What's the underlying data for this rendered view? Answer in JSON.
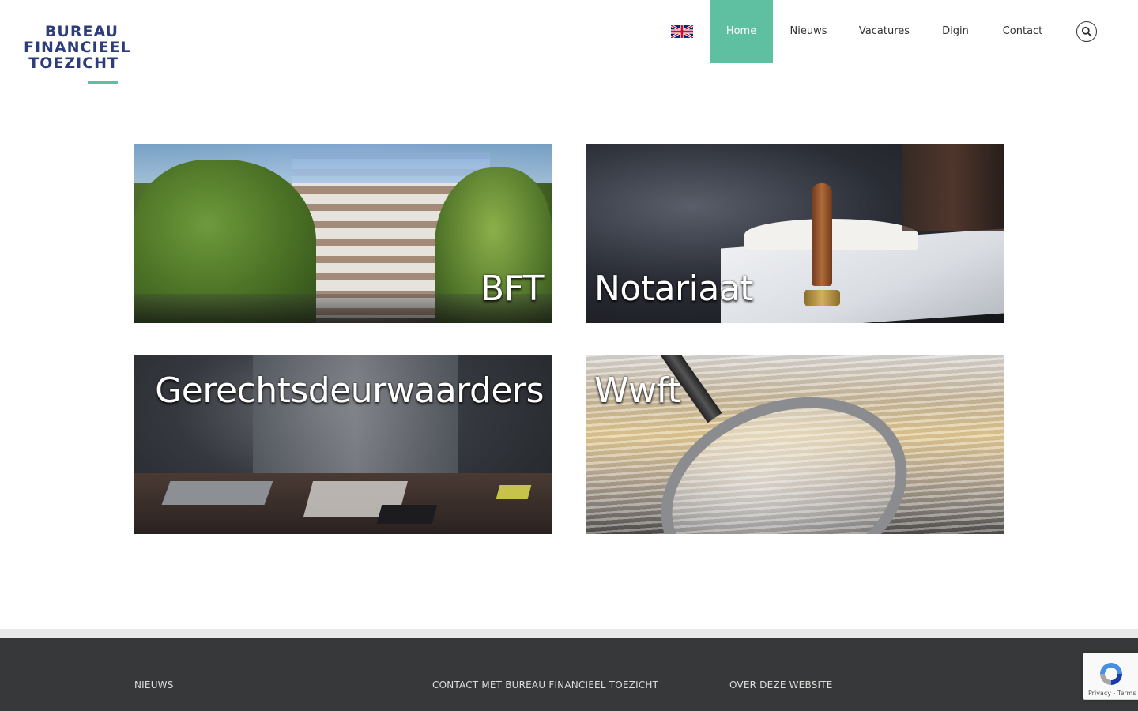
{
  "header": {
    "logo_lines": [
      "BUREAU",
      "FINANCIEEL",
      "TOEZICHT"
    ],
    "language_flag": "uk-flag-icon",
    "nav": [
      {
        "label": "Home",
        "active": true
      },
      {
        "label": "Nieuws",
        "active": false
      },
      {
        "label": "Vacatures",
        "active": false
      },
      {
        "label": "Digin",
        "active": false
      },
      {
        "label": "Contact",
        "active": false
      }
    ],
    "search_icon": "search-icon"
  },
  "tiles": [
    {
      "label": "BFT"
    },
    {
      "label": "Notariaat"
    },
    {
      "label": "Gerechtsdeurwaarders"
    },
    {
      "label": "Wwft"
    }
  ],
  "footer": {
    "columns": [
      {
        "heading": "NIEUWS"
      },
      {
        "heading": "CONTACT MET BUREAU FINANCIEEL TOEZICHT"
      },
      {
        "heading": "OVER DEZE WEBSITE"
      }
    ]
  },
  "recaptcha": {
    "links": "Privacy - Terms"
  },
  "colors": {
    "brand_navy": "#2c3d7a",
    "accent_green": "#5ec0a0",
    "footer_bg": "#363839"
  }
}
